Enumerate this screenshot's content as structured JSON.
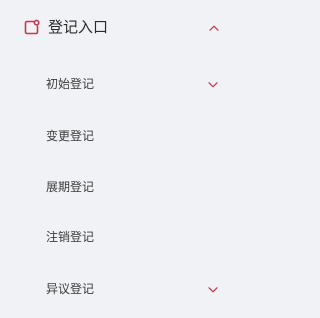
{
  "colors": {
    "background": "#f1f2f6",
    "accent": "#c0394d",
    "text_primary": "#2b2b2b",
    "text_secondary": "#3c3c3c"
  },
  "menu": {
    "header": {
      "icon": "registration-entry-icon",
      "title": "登记入口",
      "expanded": true,
      "chevron": "chevron-up-icon"
    },
    "items": [
      {
        "label": "初始登记",
        "has_submenu": true,
        "chevron": "chevron-down-icon"
      },
      {
        "label": "变更登记",
        "has_submenu": false
      },
      {
        "label": "展期登记",
        "has_submenu": false
      },
      {
        "label": "注销登记",
        "has_submenu": false
      },
      {
        "label": "异议登记",
        "has_submenu": true,
        "chevron": "chevron-down-icon"
      }
    ]
  }
}
